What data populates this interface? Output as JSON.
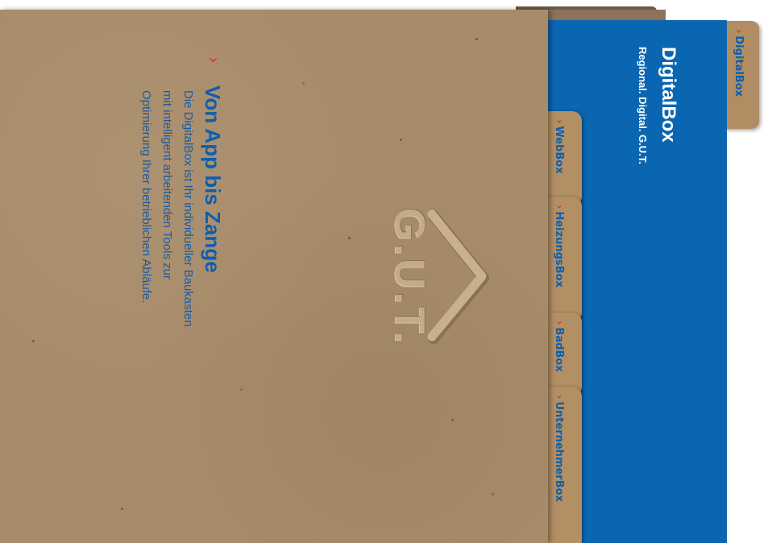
{
  "brand": {
    "title": "DigitalBox",
    "subtitle": "Regional. Digital. G.U.T.",
    "top_tab_label": "DigitalBox",
    "logo_text": "G.U.T.",
    "colors": {
      "panel_blue": "#0a66b1",
      "accent_red": "#d23b2e",
      "text_blue": "#0b5fae",
      "cardboard": "#a88c6a"
    }
  },
  "tabs": [
    {
      "label": "WebBox"
    },
    {
      "label": "HeizungsBox"
    },
    {
      "label": "BadBox"
    },
    {
      "label": "UnternehmerBox"
    }
  ],
  "content": {
    "headline": "Von App bis Zange",
    "description": "Die DigitalBox ist Ihr individueller Baukasten\nmit intelligent arbeitenden Tools zur\nOptimierung Ihrer betrieblichen Abläufe."
  },
  "icons": {
    "chevron": "chevron-right-icon",
    "logo": "gut-logo-chevron"
  }
}
